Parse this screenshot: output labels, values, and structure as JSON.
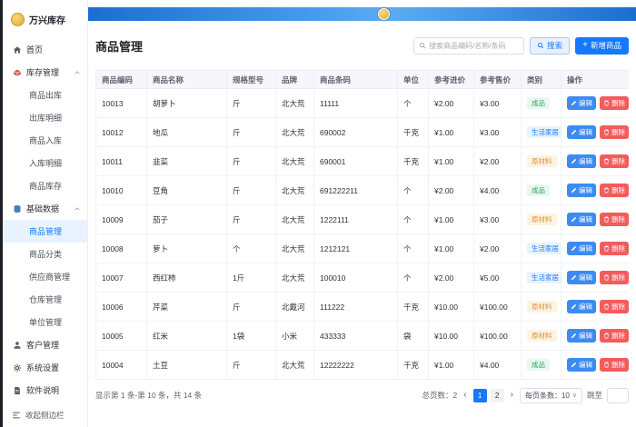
{
  "app": {
    "name": "万兴库存",
    "collapse_sidebar": "收起侧边栏"
  },
  "sidebar": {
    "items": [
      {
        "label": "首页",
        "type": "top",
        "icon": "home-icon"
      },
      {
        "label": "库存管理",
        "type": "group",
        "icon": "inventory-icon",
        "expanded": true
      },
      {
        "label": "商品出库",
        "type": "sub"
      },
      {
        "label": "出库明细",
        "type": "sub"
      },
      {
        "label": "商品入库",
        "type": "sub"
      },
      {
        "label": "入库明细",
        "type": "sub"
      },
      {
        "label": "商品库存",
        "type": "sub"
      },
      {
        "label": "基础数据",
        "type": "group",
        "icon": "database-icon",
        "expanded": true
      },
      {
        "label": "商品管理",
        "type": "sub",
        "active": true
      },
      {
        "label": "商品分类",
        "type": "sub"
      },
      {
        "label": "供应商管理",
        "type": "sub"
      },
      {
        "label": "仓库管理",
        "type": "sub"
      },
      {
        "label": "单位管理",
        "type": "sub"
      },
      {
        "label": "客户管理",
        "type": "top",
        "icon": "customer-icon"
      },
      {
        "label": "系统设置",
        "type": "top",
        "icon": "gear-icon"
      },
      {
        "label": "软件说明",
        "type": "top",
        "icon": "document-icon"
      }
    ]
  },
  "header": {
    "page_title": "商品管理",
    "search_placeholder": "搜索商品编码/名称/条码",
    "search_button": "搜索",
    "add_button": "新增商品"
  },
  "icons": {
    "add": "+",
    "prev_page": "‹",
    "next_page": "›",
    "select_chevron": "∨"
  },
  "table": {
    "headers": [
      "商品编码",
      "商品名称",
      "规格型号",
      "品牌",
      "商品条码",
      "单位",
      "参考进价",
      "参考售价",
      "类别",
      "操作"
    ],
    "edit_label": "编辑",
    "delete_label": "删除",
    "category_colors": {
      "成品": {
        "bg": "#e7f8ef",
        "text": "#2ba263"
      },
      "生活家居": {
        "bg": "#e8f3ff",
        "text": "#1677ff"
      },
      "原材料": {
        "bg": "#fdf3e3",
        "text": "#e0922f"
      }
    },
    "rows": [
      {
        "code": "10013",
        "name": "胡萝卜",
        "spec": "斤",
        "brand": "北大荒",
        "barcode": "11111",
        "unit": "个",
        "purchase": "¥2.00",
        "sale": "¥3.00",
        "category": "成品"
      },
      {
        "code": "10012",
        "name": "地瓜",
        "spec": "斤",
        "brand": "北大荒",
        "barcode": "690002",
        "unit": "千克",
        "purchase": "¥1.00",
        "sale": "¥3.00",
        "category": "生活家居"
      },
      {
        "code": "10011",
        "name": "韭菜",
        "spec": "斤",
        "brand": "北大荒",
        "barcode": "690001",
        "unit": "千克",
        "purchase": "¥1.00",
        "sale": "¥2.00",
        "category": "原材料"
      },
      {
        "code": "10010",
        "name": "豆角",
        "spec": "斤",
        "brand": "北大荒",
        "barcode": "691222211",
        "unit": "个",
        "purchase": "¥2.00",
        "sale": "¥4.00",
        "category": "成品"
      },
      {
        "code": "10009",
        "name": "茄子",
        "spec": "斤",
        "brand": "北大荒",
        "barcode": "1222111",
        "unit": "个",
        "purchase": "¥1.00",
        "sale": "¥3.00",
        "category": "原材料"
      },
      {
        "code": "10008",
        "name": "萝卜",
        "spec": "个",
        "brand": "北大荒",
        "barcode": "1212121",
        "unit": "个",
        "purchase": "¥1.00",
        "sale": "¥2.00",
        "category": "生活家居"
      },
      {
        "code": "10007",
        "name": "西红柿",
        "spec": "1斤",
        "brand": "北大荒",
        "barcode": "100010",
        "unit": "个",
        "purchase": "¥2.00",
        "sale": "¥5.00",
        "category": "生活家居"
      },
      {
        "code": "10006",
        "name": "芹菜",
        "spec": "斤",
        "brand": "北戴河",
        "barcode": "111222",
        "unit": "千克",
        "purchase": "¥10.00",
        "sale": "¥100.00",
        "category": "原材料"
      },
      {
        "code": "10005",
        "name": "红米",
        "spec": "1袋",
        "brand": "小米",
        "barcode": "433333",
        "unit": "袋",
        "purchase": "¥10.00",
        "sale": "¥100.00",
        "category": "原材料"
      },
      {
        "code": "10004",
        "name": "土豆",
        "spec": "斤",
        "brand": "北大荒",
        "barcode": "12222222",
        "unit": "千克",
        "purchase": "¥1.00",
        "sale": "¥4.00",
        "category": "成品"
      }
    ]
  },
  "pagination": {
    "summary": "显示第 1 条-第 10 条，共 14 条",
    "total_pages": "总页数：2",
    "pages": [
      "1",
      "2"
    ],
    "active_page": "1",
    "per_page": "每页条数：10",
    "jump_label": "跳至"
  }
}
